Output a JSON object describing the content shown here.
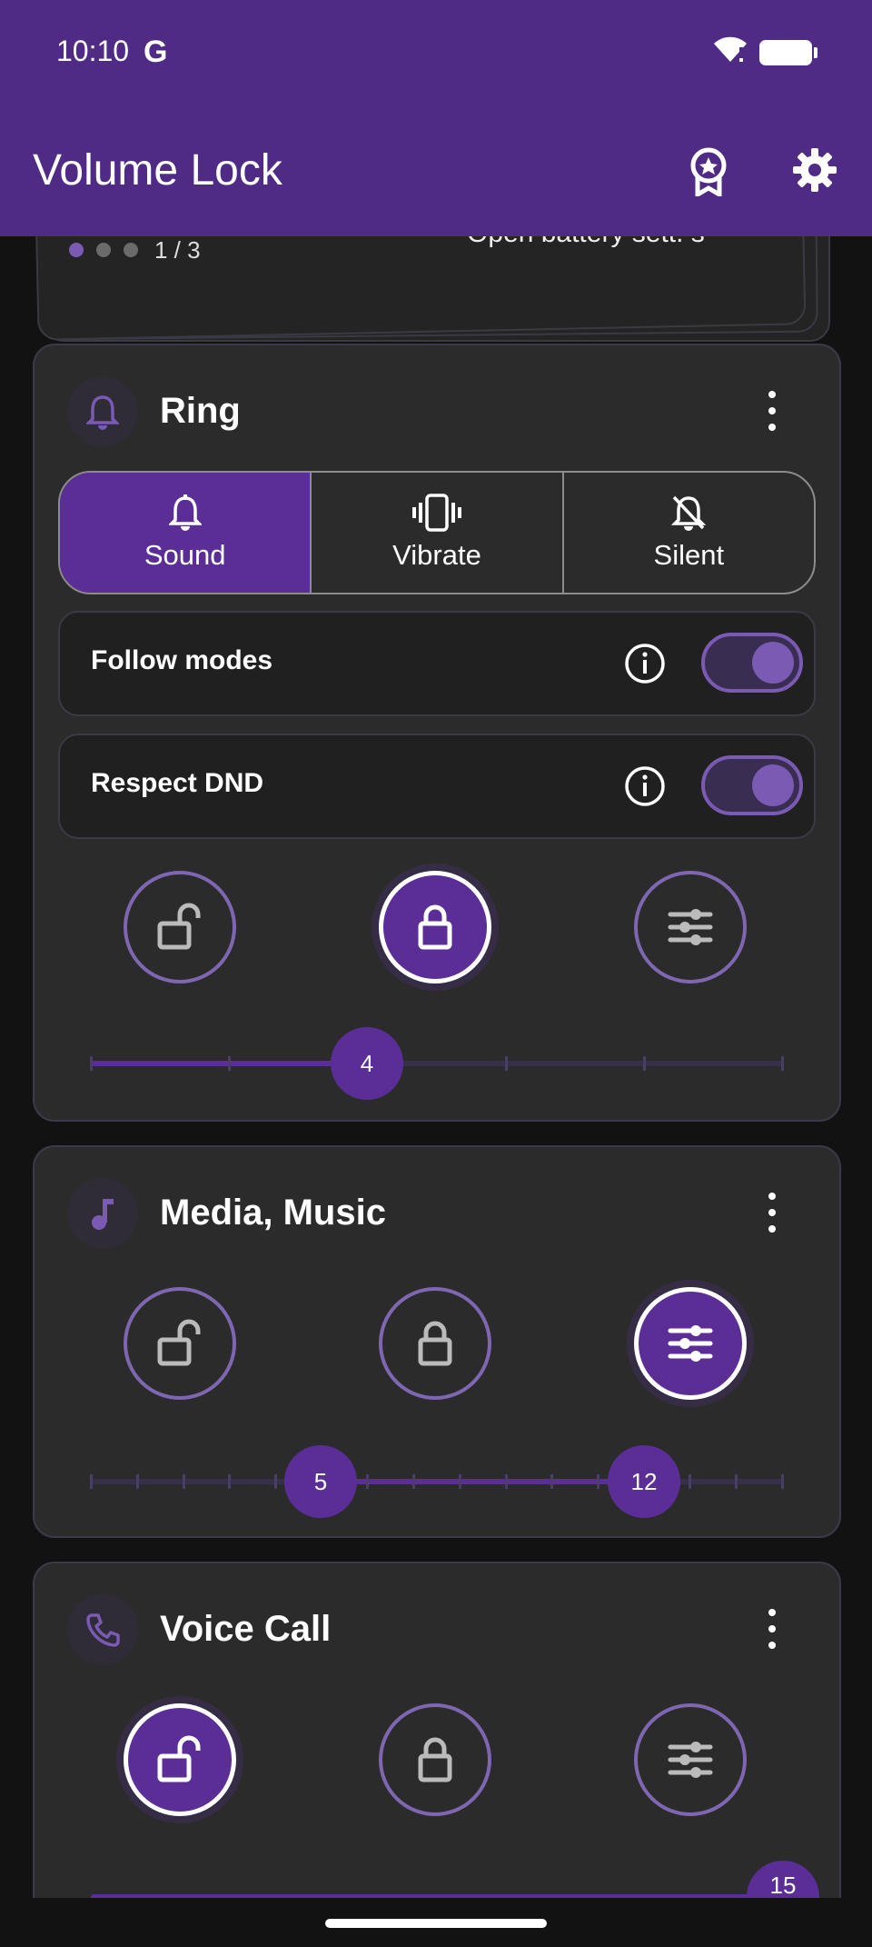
{
  "status": {
    "time": "10:10",
    "g_label": "G"
  },
  "app": {
    "title": "Volume Lock"
  },
  "tips": {
    "counter": "1 / 3",
    "text": "Open battery sett. s"
  },
  "cards": [
    {
      "title": "Ring",
      "segments": [
        {
          "label": "Sound"
        },
        {
          "label": "Vibrate"
        },
        {
          "label": "Silent"
        }
      ],
      "toggles": [
        {
          "label": "Follow modes"
        },
        {
          "label": "Respect DND"
        }
      ],
      "slider": {
        "value": "4"
      }
    },
    {
      "title": "Media, Music",
      "slider": {
        "low": "5",
        "high": "12"
      }
    },
    {
      "title": "Voice Call",
      "slider": {
        "value": "15"
      }
    }
  ],
  "colors": {
    "accent": "#5b2e97",
    "appbar": "#4f2b85",
    "card": "#2b2b2b",
    "outline": "#7f66b2"
  }
}
